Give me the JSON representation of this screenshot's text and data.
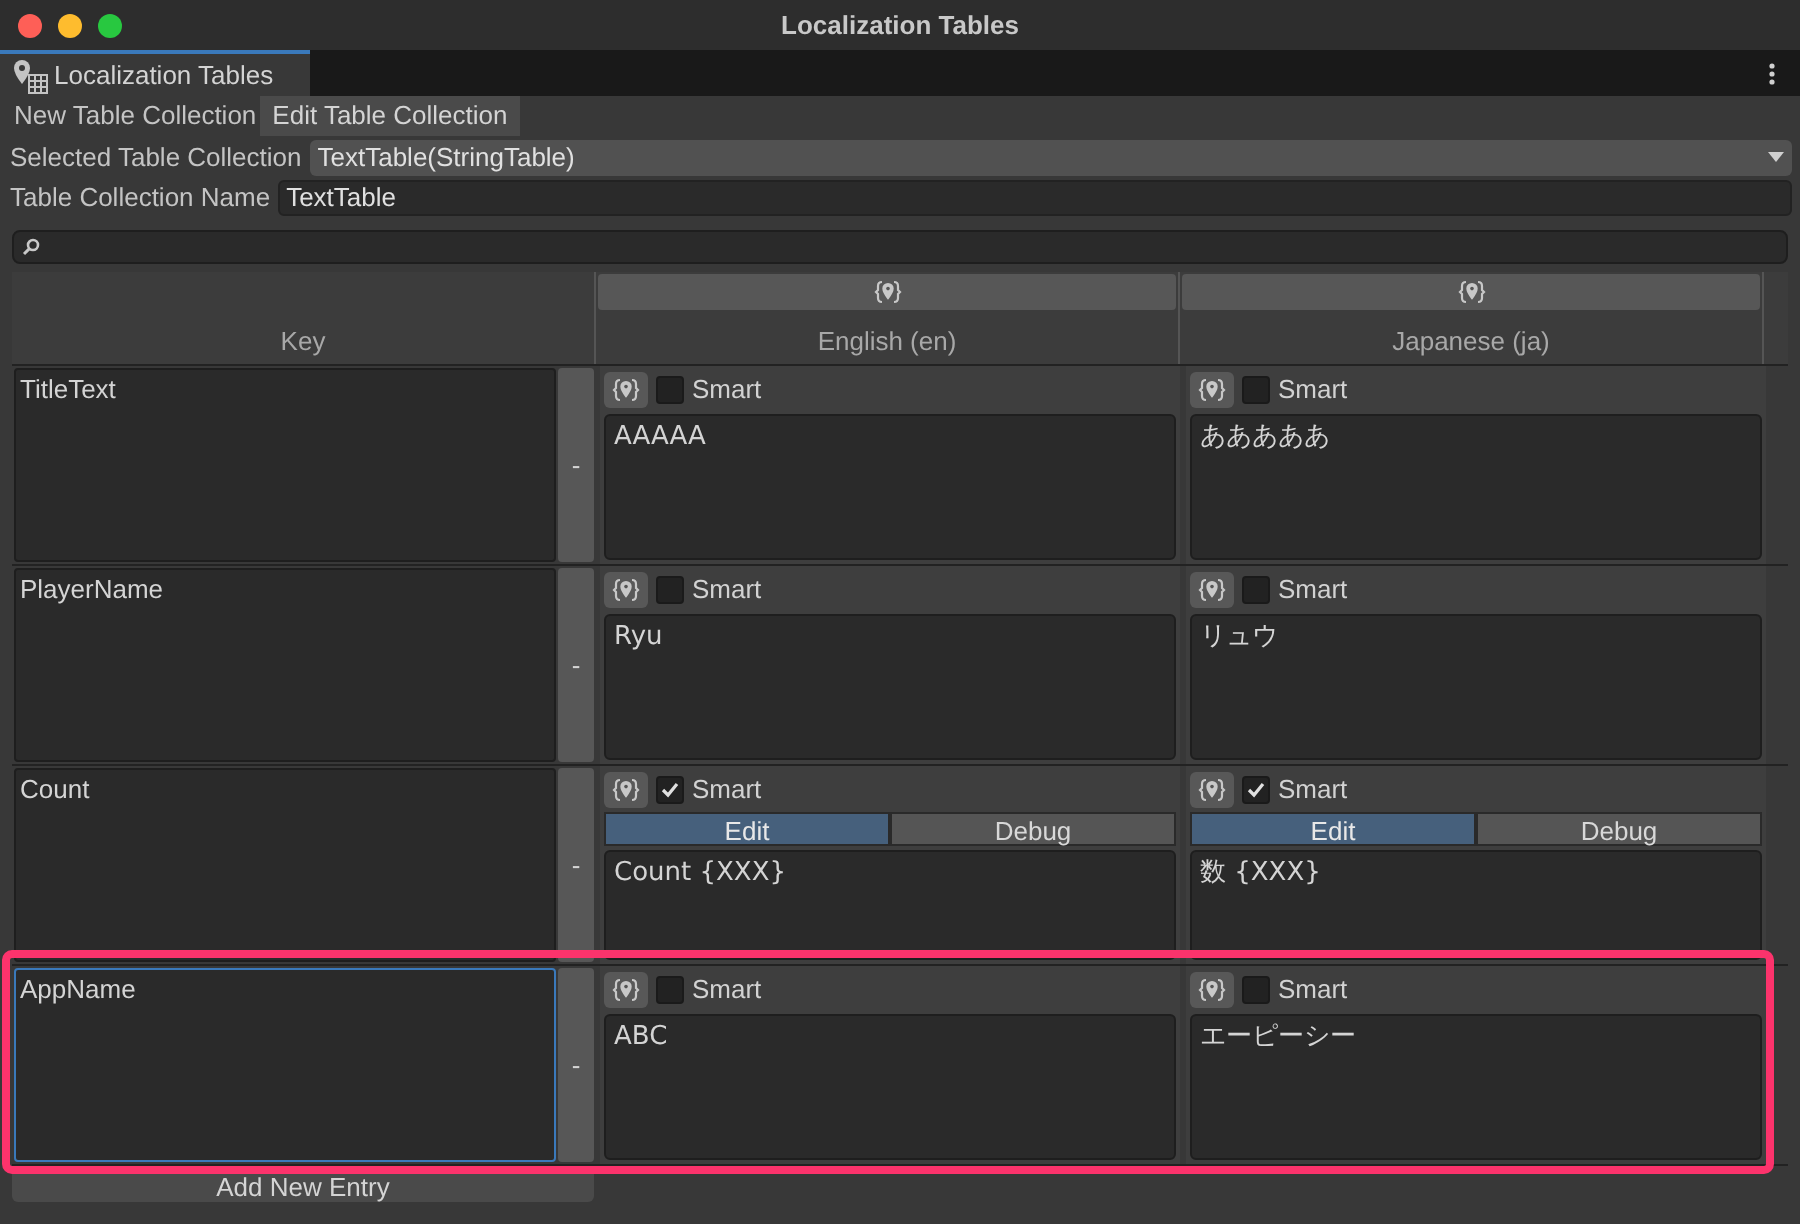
{
  "window": {
    "title": "Localization Tables"
  },
  "editor_tab": {
    "label": "Localization Tables"
  },
  "mode_tabs": [
    {
      "label": "New Table Collection",
      "selected": false
    },
    {
      "label": "Edit Table Collection",
      "selected": true
    }
  ],
  "selected_table_collection": {
    "label": "Selected Table Collection",
    "value": "TextTable(StringTable)"
  },
  "table_collection_name": {
    "label": "Table Collection Name",
    "value": "TextTable"
  },
  "table": {
    "key_header": "Key",
    "locales": [
      "English (en)",
      "Japanese (ja)"
    ],
    "rows": [
      {
        "key": "TitleText",
        "focused": false,
        "highlighted": false,
        "remove": "-",
        "entries": [
          {
            "smart": false,
            "smart_label": "Smart",
            "text": "AAAAA"
          },
          {
            "smart": false,
            "smart_label": "Smart",
            "text": "あああああ"
          }
        ]
      },
      {
        "key": "PlayerName",
        "focused": false,
        "highlighted": false,
        "remove": "-",
        "entries": [
          {
            "smart": false,
            "smart_label": "Smart",
            "text": "Ryu"
          },
          {
            "smart": false,
            "smart_label": "Smart",
            "text": "リュウ"
          }
        ]
      },
      {
        "key": "Count",
        "focused": false,
        "highlighted": false,
        "remove": "-",
        "entries": [
          {
            "smart": true,
            "smart_label": "Smart",
            "modes": [
              {
                "label": "Edit",
                "selected": true
              },
              {
                "label": "Debug",
                "selected": false
              }
            ],
            "text": "Count {XXX}"
          },
          {
            "smart": true,
            "smart_label": "Smart",
            "modes": [
              {
                "label": "Edit",
                "selected": true
              },
              {
                "label": "Debug",
                "selected": false
              }
            ],
            "text": "数 {XXX}"
          }
        ]
      },
      {
        "key": "AppName",
        "focused": true,
        "highlighted": true,
        "remove": "-",
        "entries": [
          {
            "smart": false,
            "smart_label": "Smart",
            "text": "ABC"
          },
          {
            "smart": false,
            "smart_label": "Smart",
            "text": "エーピーシー"
          }
        ]
      }
    ]
  },
  "add_entry": "Add New Entry"
}
